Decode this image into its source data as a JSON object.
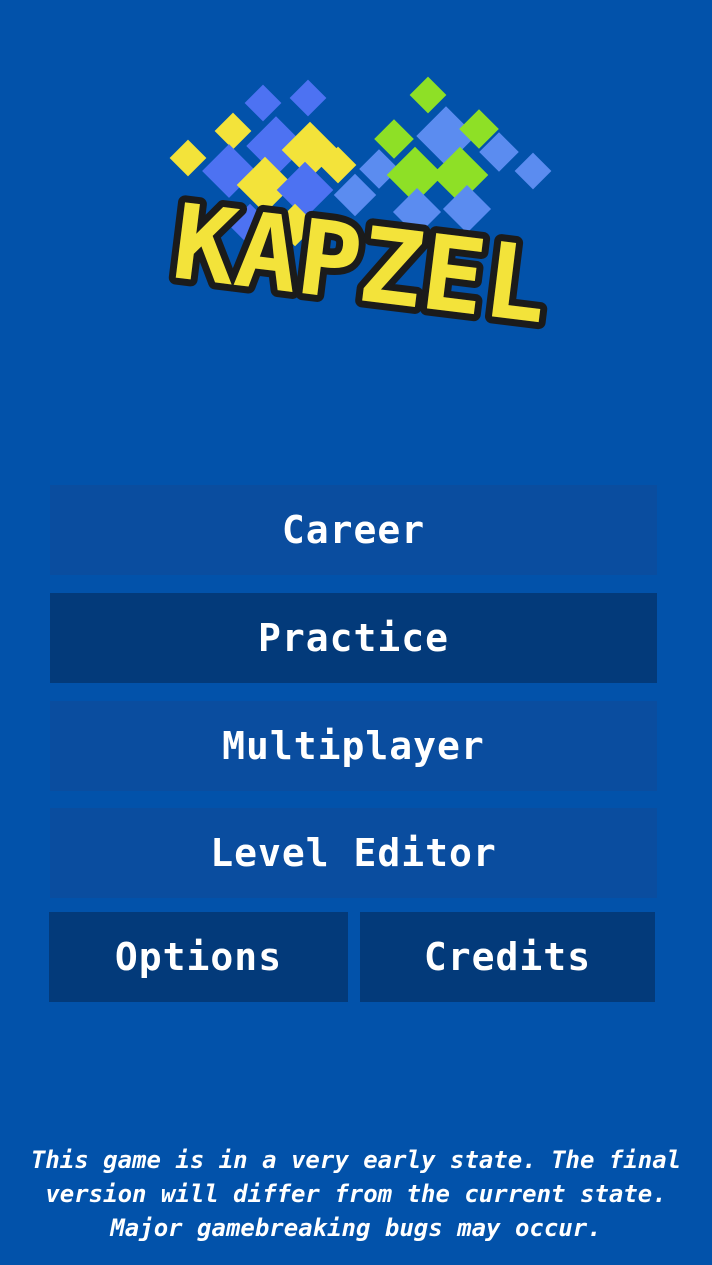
{
  "logo": {
    "text": "KAPZEL",
    "colors": {
      "yellow": "#f3e33a",
      "blue": "#4d72f2",
      "green": "#8ee026",
      "light_blue": "#5b8cf0",
      "outline": "#1b1b1b"
    }
  },
  "menu": {
    "career": "Career",
    "practice": "Practice",
    "multiplayer": "Multiplayer",
    "level_editor": "Level Editor",
    "options": "Options",
    "credits": "Credits"
  },
  "notice": "This game is in a very early state. The final version will differ from the current state. Major gamebreaking bugs may occur.",
  "colors": {
    "background": "#0252aa",
    "button_light": "#0a4d9f",
    "button_dark": "#033a7a",
    "text": "#ffffff"
  }
}
